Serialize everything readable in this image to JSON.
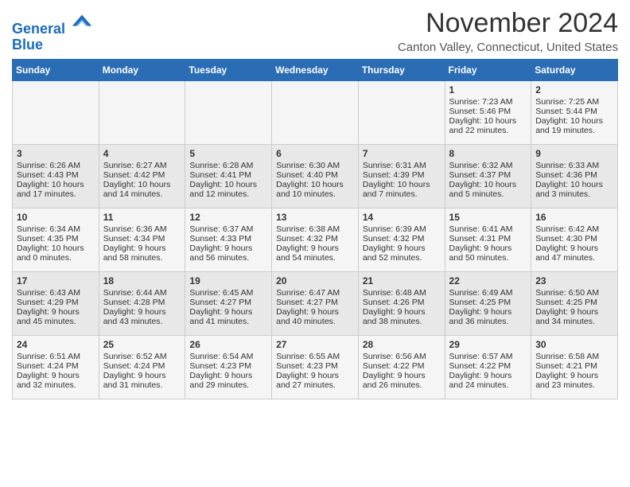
{
  "header": {
    "logo_line1": "General",
    "logo_line2": "Blue",
    "month": "November 2024",
    "location": "Canton Valley, Connecticut, United States"
  },
  "weekdays": [
    "Sunday",
    "Monday",
    "Tuesday",
    "Wednesday",
    "Thursday",
    "Friday",
    "Saturday"
  ],
  "weeks": [
    [
      {
        "day": "",
        "info": ""
      },
      {
        "day": "",
        "info": ""
      },
      {
        "day": "",
        "info": ""
      },
      {
        "day": "",
        "info": ""
      },
      {
        "day": "",
        "info": ""
      },
      {
        "day": "1",
        "info": "Sunrise: 7:23 AM\nSunset: 5:46 PM\nDaylight: 10 hours and 22 minutes."
      },
      {
        "day": "2",
        "info": "Sunrise: 7:25 AM\nSunset: 5:44 PM\nDaylight: 10 hours and 19 minutes."
      }
    ],
    [
      {
        "day": "3",
        "info": "Sunrise: 6:26 AM\nSunset: 4:43 PM\nDaylight: 10 hours and 17 minutes."
      },
      {
        "day": "4",
        "info": "Sunrise: 6:27 AM\nSunset: 4:42 PM\nDaylight: 10 hours and 14 minutes."
      },
      {
        "day": "5",
        "info": "Sunrise: 6:28 AM\nSunset: 4:41 PM\nDaylight: 10 hours and 12 minutes."
      },
      {
        "day": "6",
        "info": "Sunrise: 6:30 AM\nSunset: 4:40 PM\nDaylight: 10 hours and 10 minutes."
      },
      {
        "day": "7",
        "info": "Sunrise: 6:31 AM\nSunset: 4:39 PM\nDaylight: 10 hours and 7 minutes."
      },
      {
        "day": "8",
        "info": "Sunrise: 6:32 AM\nSunset: 4:37 PM\nDaylight: 10 hours and 5 minutes."
      },
      {
        "day": "9",
        "info": "Sunrise: 6:33 AM\nSunset: 4:36 PM\nDaylight: 10 hours and 3 minutes."
      }
    ],
    [
      {
        "day": "10",
        "info": "Sunrise: 6:34 AM\nSunset: 4:35 PM\nDaylight: 10 hours and 0 minutes."
      },
      {
        "day": "11",
        "info": "Sunrise: 6:36 AM\nSunset: 4:34 PM\nDaylight: 9 hours and 58 minutes."
      },
      {
        "day": "12",
        "info": "Sunrise: 6:37 AM\nSunset: 4:33 PM\nDaylight: 9 hours and 56 minutes."
      },
      {
        "day": "13",
        "info": "Sunrise: 6:38 AM\nSunset: 4:32 PM\nDaylight: 9 hours and 54 minutes."
      },
      {
        "day": "14",
        "info": "Sunrise: 6:39 AM\nSunset: 4:32 PM\nDaylight: 9 hours and 52 minutes."
      },
      {
        "day": "15",
        "info": "Sunrise: 6:41 AM\nSunset: 4:31 PM\nDaylight: 9 hours and 50 minutes."
      },
      {
        "day": "16",
        "info": "Sunrise: 6:42 AM\nSunset: 4:30 PM\nDaylight: 9 hours and 47 minutes."
      }
    ],
    [
      {
        "day": "17",
        "info": "Sunrise: 6:43 AM\nSunset: 4:29 PM\nDaylight: 9 hours and 45 minutes."
      },
      {
        "day": "18",
        "info": "Sunrise: 6:44 AM\nSunset: 4:28 PM\nDaylight: 9 hours and 43 minutes."
      },
      {
        "day": "19",
        "info": "Sunrise: 6:45 AM\nSunset: 4:27 PM\nDaylight: 9 hours and 41 minutes."
      },
      {
        "day": "20",
        "info": "Sunrise: 6:47 AM\nSunset: 4:27 PM\nDaylight: 9 hours and 40 minutes."
      },
      {
        "day": "21",
        "info": "Sunrise: 6:48 AM\nSunset: 4:26 PM\nDaylight: 9 hours and 38 minutes."
      },
      {
        "day": "22",
        "info": "Sunrise: 6:49 AM\nSunset: 4:25 PM\nDaylight: 9 hours and 36 minutes."
      },
      {
        "day": "23",
        "info": "Sunrise: 6:50 AM\nSunset: 4:25 PM\nDaylight: 9 hours and 34 minutes."
      }
    ],
    [
      {
        "day": "24",
        "info": "Sunrise: 6:51 AM\nSunset: 4:24 PM\nDaylight: 9 hours and 32 minutes."
      },
      {
        "day": "25",
        "info": "Sunrise: 6:52 AM\nSunset: 4:24 PM\nDaylight: 9 hours and 31 minutes."
      },
      {
        "day": "26",
        "info": "Sunrise: 6:54 AM\nSunset: 4:23 PM\nDaylight: 9 hours and 29 minutes."
      },
      {
        "day": "27",
        "info": "Sunrise: 6:55 AM\nSunset: 4:23 PM\nDaylight: 9 hours and 27 minutes."
      },
      {
        "day": "28",
        "info": "Sunrise: 6:56 AM\nSunset: 4:22 PM\nDaylight: 9 hours and 26 minutes."
      },
      {
        "day": "29",
        "info": "Sunrise: 6:57 AM\nSunset: 4:22 PM\nDaylight: 9 hours and 24 minutes."
      },
      {
        "day": "30",
        "info": "Sunrise: 6:58 AM\nSunset: 4:21 PM\nDaylight: 9 hours and 23 minutes."
      }
    ]
  ]
}
